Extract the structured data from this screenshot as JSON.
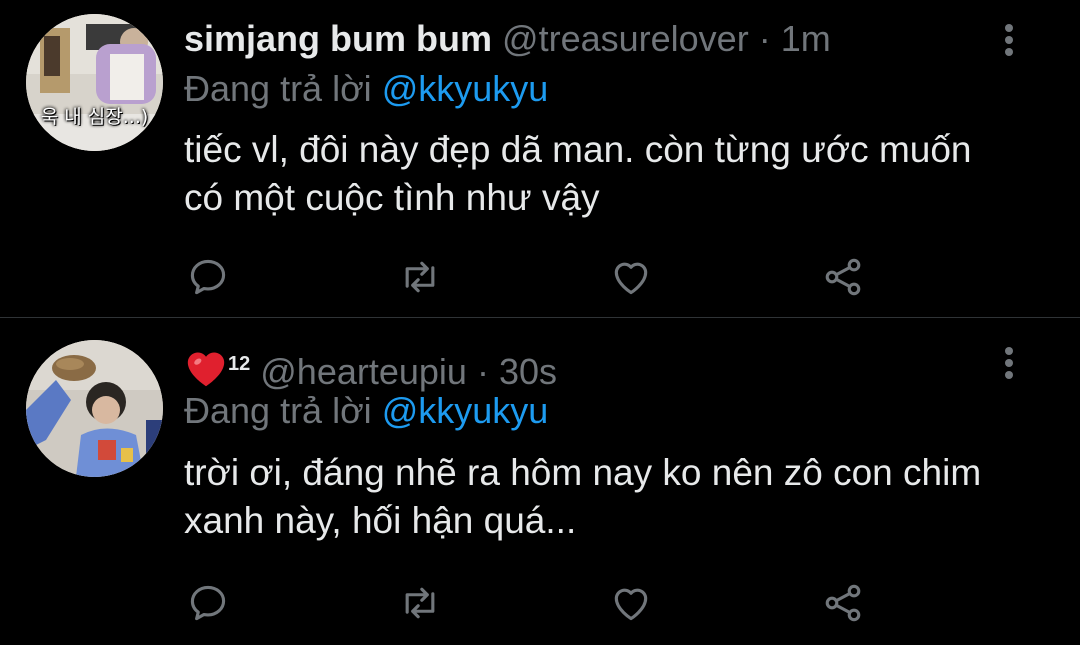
{
  "tweets": [
    {
      "display_name": "simjang bum bum",
      "handle": "@treasurelover",
      "separator": "·",
      "time": "1m",
      "reply_prefix": "Đang trả lời",
      "reply_to": "@kkyukyu",
      "text": "tiếc vl, đôi này đẹp dã man. còn từng ước muốn có một cuộc tình như vậy",
      "avatar_caption": "욱 내 심장...)"
    },
    {
      "display_name_emoji": "heart-emoji",
      "display_name_suffix": "12",
      "handle": "@hearteupiu",
      "separator": "·",
      "time": "30s",
      "reply_prefix": "Đang trả lời",
      "reply_to": "@kkyukyu",
      "text": "trời ơi, đáng nhẽ ra hôm nay ko nên zô con chim xanh này, hối hận quá..."
    }
  ],
  "icons": {
    "reply": "reply-icon",
    "retweet": "retweet-icon",
    "like": "heart-outline-icon",
    "share": "share-icon",
    "more": "more-vertical-icon"
  },
  "colors": {
    "background": "#000000",
    "primary_text": "#e7e9ea",
    "secondary_text": "#71767b",
    "link": "#1d9bf0",
    "divider": "#2f3336",
    "heart": "#e0202e"
  }
}
